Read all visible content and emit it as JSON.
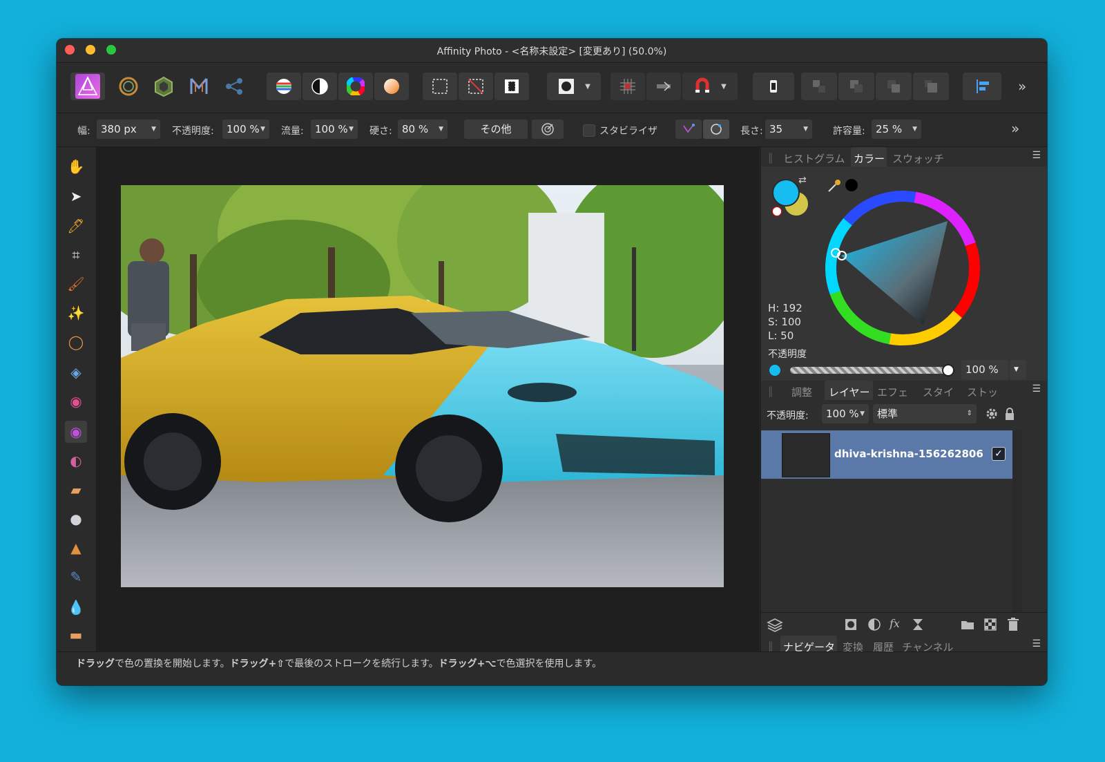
{
  "window": {
    "title": "Affinity Photo - <名称未設定> [変更あり] (50.0%)"
  },
  "context_toolbar": {
    "width_label": "幅:",
    "width_value": "380 px",
    "opacity_label": "不透明度:",
    "opacity_value": "100 %",
    "flow_label": "流量:",
    "flow_value": "100 %",
    "hardness_label": "硬さ:",
    "hardness_value": "80 %",
    "more_button": "その他",
    "stabilizer_label": "スタビライザ",
    "length_label": "長さ:",
    "length_value": "35",
    "tolerance_label": "許容量:",
    "tolerance_value": "25 %",
    "overflow": "»"
  },
  "toolbar": {
    "overflow": "»"
  },
  "color_panel": {
    "tabs": [
      "ヒストグラム",
      "カラー",
      "スウォッチ"
    ],
    "active_tab": "カラー",
    "h_label": "H: 192",
    "s_label": "S: 100",
    "l_label": "L: 50",
    "opacity_label": "不透明度",
    "opacity_value": "100 %",
    "primary_color": "#16bdf0",
    "secondary_color": "#d3c74a"
  },
  "layers_panel": {
    "tabs": [
      "調整",
      "レイヤー",
      "エフェ",
      "スタイ",
      "ストッ"
    ],
    "active_tab": "レイヤー",
    "opacity_label": "不透明度:",
    "opacity_value": "100 %",
    "blend_mode": "標準",
    "layers": [
      {
        "name": "dhiva-krishna-156262806",
        "visible": true
      }
    ]
  },
  "navigator_panel": {
    "tabs": [
      "ナビゲータ",
      "変換",
      "履歴",
      "チャンネル"
    ],
    "active_tab": "ナビゲータ"
  },
  "status_bar": {
    "drag1": "ドラッグ",
    "t1": "で色の置換を開始します。",
    "drag2": "ドラッグ+⇧",
    "t2": "で最後のストロークを続行します。",
    "drag3": "ドラッグ+⌥",
    "t3": "で色選択を使用します。"
  },
  "colors": {
    "desktop": "#12b1dc",
    "accent_selection": "#5a79a8",
    "tl_close": "#ff5f57",
    "tl_min": "#febc2e",
    "tl_max": "#28c840"
  },
  "tools": [
    "hand-icon",
    "move-icon",
    "color-picker-icon",
    "crop-icon",
    "paint-brush-icon",
    "magic-wand-icon",
    "lasso-icon",
    "flood-fill-icon",
    "color-replacement-icon",
    "active-color-replace-icon",
    "selection-brush-icon",
    "erase-icon",
    "zoom-icon",
    "clone-stamp-icon",
    "patch-icon",
    "blur-icon",
    "healing-icon"
  ]
}
